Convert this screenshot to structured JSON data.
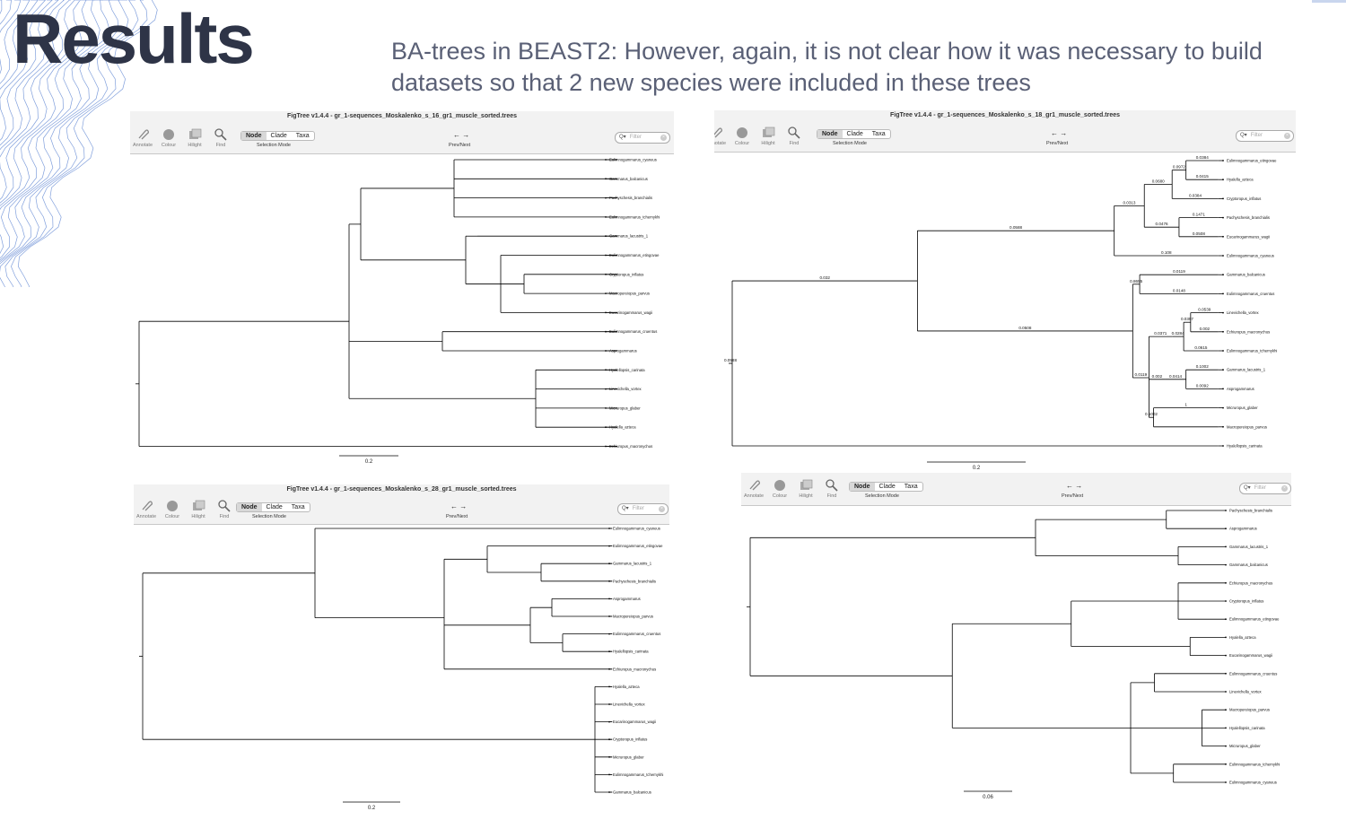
{
  "slide": {
    "title": "Results",
    "subtitle": "BA-trees in BEAST2: However, again, it is not clear how it was necessary to build datasets so that 2 new species were included in these trees"
  },
  "toolbar": {
    "annotate": "Annotate",
    "colour": "Colour",
    "hilight": "Hilight",
    "find": "Find",
    "node": "Node",
    "clade": "Clade",
    "taxa": "Taxa",
    "selection_mode": "Selection Mode",
    "prev_next": "Prev/Next",
    "filter": "Filter"
  },
  "windows": [
    {
      "title": "FigTree v1.4.4 - gr_1-sequences_Moskalenko_s_16_gr1_muscle_sorted.trees",
      "scale": "0.2",
      "tips": [
        "Eulimnogammarus_cyaneus",
        "Gammarus_balcanicus",
        "Pachyschesis_branchialis",
        "Eulimnogammarus_tchernykhi",
        "Gammarus_lacustris_1",
        "Eulimnogammarus_etingovae",
        "Cryptoropus_inflatus",
        "Macropereiopus_parvus",
        "Eucarinogammarus_wagii",
        "Eulimnogammarus_cruentus",
        "Asprogammarus",
        "Hyalellopsis_carinata",
        "Linevichella_vortex",
        "Micruropus_glaber",
        "Hyalella_azteca",
        "Echiuropus_macronychus"
      ],
      "branch_labels": []
    },
    {
      "title": "FigTree v1.4.4 - gr_1-sequences_Moskalenko_s_18_gr1_muscle_sorted.trees",
      "scale": "0.2",
      "tips": [
        "Eulimnogammarus_etingovae",
        "Hyalella_azteca",
        "Cryptoropus_inflatus",
        "Pachyschesis_branchialis",
        "Eucarinogammarus_wagii",
        "Eulimnogammarus_cyaneus",
        "Gammarus_balcanicus",
        "Eulimnogammarus_cruentus",
        "Linevichella_vortex",
        "Echiuropus_macronychus",
        "Eulimnogammarus_tchernykhi",
        "Gammarus_lacustris_1",
        "Asprogammarus",
        "Micruropus_glaber",
        "Macropereiopus_parvus",
        "Hyalellopsis_carinata"
      ],
      "branch_labels": [
        "0.0588",
        "0.032",
        "0.0588",
        "0.0313",
        "0.0680",
        "0.0972",
        "0.0384",
        "0.0415",
        "0.0384",
        "0.0476",
        "0.1471",
        "0.0508",
        "0.108",
        "0.0508",
        "0.8655",
        "0.0119",
        "0.0148",
        "0.0119",
        "0.0371",
        "0.0284",
        "0.0357",
        "0.0539",
        "0.002",
        "0.0615",
        "0.002",
        "0.0414",
        "0.1002",
        "0.0092",
        "0.1002",
        "1"
      ]
    },
    {
      "title": "FigTree v1.4.4 - gr_1-sequences_Moskalenko_s_28_gr1_muscle_sorted.trees",
      "scale": "0.2",
      "tips": [
        "Eulimnogammarus_cyaneus",
        "Eulimnogammarus_etingovae",
        "Gammarus_lacustris_1",
        "Pachyschesis_branchialis",
        "Asprogammarus",
        "Macropereiopus_parvus",
        "Eulimnogammarus_cruentus",
        "Hyalellopsis_carinata",
        "Echiuropus_macronychus",
        "Hyalella_azteca",
        "Linevichella_vortex",
        "Eucarinogammarus_wagii",
        "Cryptoropus_inflatus",
        "Micruropus_glaber",
        "Eulimnogammarus_tchernykhi",
        "Gammarus_balcanicus"
      ],
      "branch_labels": []
    },
    {
      "title": "",
      "scale": "0.06",
      "tips": [
        "Pachyschesis_branchialis",
        "Asprogammarus",
        "Gammarus_lacustris_1",
        "Gammarus_balcanicus",
        "Echiuropus_macronychus",
        "Cryptoropus_inflatus",
        "Eulimnogammarus_etingovae",
        "Hyalella_azteca",
        "Eucarinogammarus_wagii",
        "Eulimnogammarus_cruentus",
        "Linevichella_vortex",
        "Macropereiopus_parvus",
        "Hyalellopsis_carinata",
        "Micruropus_glaber",
        "Eulimnogammarus_tchernykhi",
        "Eulimnogammarus_cyaneus"
      ],
      "branch_labels": []
    }
  ]
}
